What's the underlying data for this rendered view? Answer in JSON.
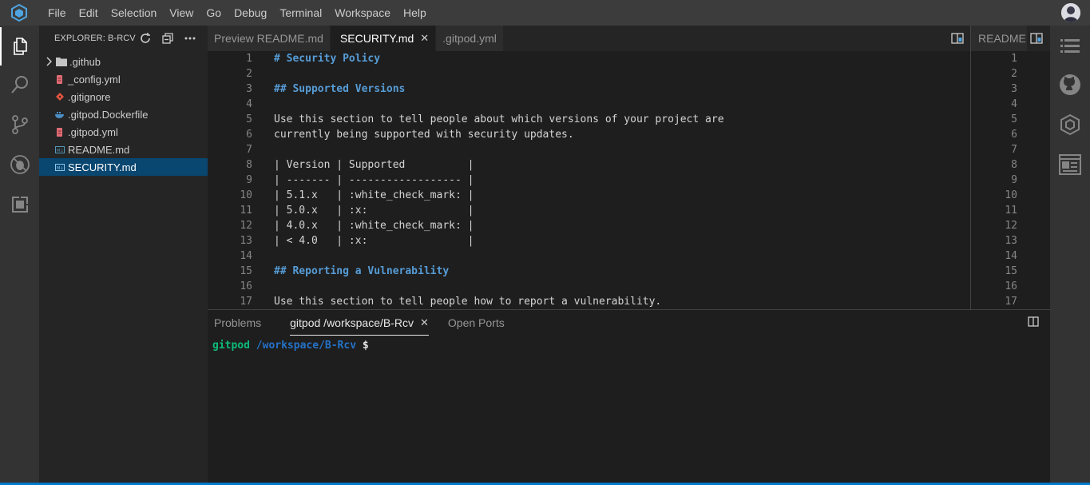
{
  "menubar": {
    "items": [
      "File",
      "Edit",
      "Selection",
      "View",
      "Go",
      "Debug",
      "Terminal",
      "Workspace",
      "Help"
    ],
    "logo_icon": "gitpod-cube-icon",
    "avatar_icon": "user-avatar-icon"
  },
  "activitybar": {
    "items": [
      {
        "icon": "files-icon",
        "active": true
      },
      {
        "icon": "search-icon"
      },
      {
        "icon": "source-control-icon"
      },
      {
        "icon": "debug-icon"
      },
      {
        "icon": "extensions-icon"
      }
    ]
  },
  "sidebar": {
    "title": "EXPLORER: B-RCV",
    "actions": [
      "refresh-icon",
      "collapse-all-icon",
      "more-icon"
    ],
    "files": [
      {
        "label": ".github",
        "type": "folder",
        "icon": "folder-icon"
      },
      {
        "label": "_config.yml",
        "type": "yml",
        "icon": "yml-file-icon"
      },
      {
        "label": ".gitignore",
        "type": "git",
        "icon": "git-file-icon"
      },
      {
        "label": ".gitpod.Dockerfile",
        "type": "docker",
        "icon": "docker-file-icon"
      },
      {
        "label": ".gitpod.yml",
        "type": "yml",
        "icon": "yml-file-icon"
      },
      {
        "label": "README.md",
        "type": "md",
        "icon": "markdown-file-icon"
      },
      {
        "label": "SECURITY.md",
        "type": "md",
        "icon": "markdown-file-icon",
        "selected": true
      }
    ]
  },
  "editor": {
    "tabs": [
      {
        "label": "Preview README.md",
        "active": false
      },
      {
        "label": "SECURITY.md",
        "active": true
      },
      {
        "label": ".gitpod.yml",
        "active": false
      }
    ],
    "split_icon": "open-preview-icon",
    "lines": [
      {
        "n": "1",
        "text": "# Security Policy",
        "kind": "heading"
      },
      {
        "n": "2",
        "text": "",
        "kind": "text"
      },
      {
        "n": "3",
        "text": "## Supported Versions",
        "kind": "heading"
      },
      {
        "n": "4",
        "text": "",
        "kind": "text"
      },
      {
        "n": "5",
        "text": "Use this section to tell people about which versions of your project are",
        "kind": "text"
      },
      {
        "n": "6",
        "text": "currently being supported with security updates.",
        "kind": "text"
      },
      {
        "n": "7",
        "text": "",
        "kind": "text"
      },
      {
        "n": "8",
        "text": "| Version | Supported          |",
        "kind": "text"
      },
      {
        "n": "9",
        "text": "| ------- | ------------------ |",
        "kind": "text"
      },
      {
        "n": "10",
        "text": "| 5.1.x   | :white_check_mark: |",
        "kind": "text"
      },
      {
        "n": "11",
        "text": "| 5.0.x   | :x:                |",
        "kind": "text"
      },
      {
        "n": "12",
        "text": "| 4.0.x   | :white_check_mark: |",
        "kind": "text"
      },
      {
        "n": "13",
        "text": "| < 4.0   | :x:                |",
        "kind": "text"
      },
      {
        "n": "14",
        "text": "",
        "kind": "text"
      },
      {
        "n": "15",
        "text": "## Reporting a Vulnerability",
        "kind": "heading"
      },
      {
        "n": "16",
        "text": "",
        "kind": "text"
      },
      {
        "n": "17",
        "text": "Use this section to tell people how to report a vulnerability.",
        "kind": "text"
      }
    ]
  },
  "editor2": {
    "tab_label": "README",
    "split_icon": "open-preview-icon",
    "line_numbers": [
      "1",
      "2",
      "3",
      "4",
      "5",
      "6",
      "7",
      "8",
      "9",
      "10",
      "11",
      "12",
      "13",
      "14",
      "15",
      "16",
      "17"
    ]
  },
  "rightbar": {
    "items": [
      "outline-icon",
      "github-icon",
      "gitpod-cube-icon",
      "preview-icon"
    ]
  },
  "panel": {
    "tabs": [
      {
        "label": "Problems",
        "active": false
      },
      {
        "label": "gitpod /workspace/B-Rcv",
        "active": true
      },
      {
        "label": "Open Ports",
        "active": false
      }
    ],
    "split_icon": "split-panel-icon",
    "terminal": {
      "user": "gitpod",
      "path": "/workspace/B-Rcv",
      "prompt": "$"
    }
  },
  "colors": {
    "accent": "#007acc",
    "selection": "#094771",
    "heading": "#569cd6",
    "terminal_user": "#0dbc79",
    "terminal_path": "#2472c8"
  }
}
